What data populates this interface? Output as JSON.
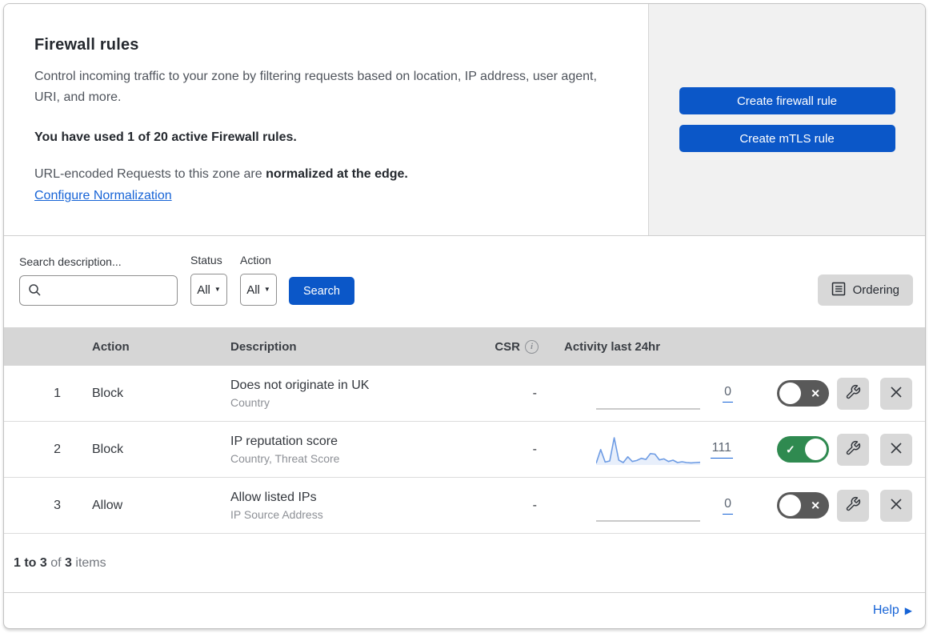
{
  "header": {
    "title": "Firewall rules",
    "description": "Control incoming traffic to your zone by filtering requests based on location, IP address, user agent, URI, and more.",
    "usage_note": "You have used 1 of 20 active Firewall rules.",
    "normalization_text": "URL-encoded Requests to this zone are ",
    "normalization_bold": "normalized at the edge.",
    "normalization_link": "Configure Normalization",
    "create_firewall_button": "Create firewall rule",
    "create_mtls_button": "Create mTLS rule"
  },
  "filters": {
    "search_label": "Search description...",
    "status_label": "Status",
    "status_value": "All",
    "action_label": "Action",
    "action_value": "All",
    "search_button": "Search",
    "ordering_button": "Ordering"
  },
  "table": {
    "columns": {
      "action": "Action",
      "description": "Description",
      "csr": "CSR",
      "activity": "Activity last 24hr"
    },
    "rows": [
      {
        "index": "1",
        "action": "Block",
        "description": "Does not originate in UK",
        "fields": "Country",
        "csr": "-",
        "activity_count": "0",
        "enabled": false,
        "sparkline": [
          0,
          0,
          0,
          0,
          0,
          0,
          0,
          0,
          0,
          0,
          0,
          0,
          0,
          0,
          0,
          0,
          0,
          0,
          0,
          0,
          0,
          0,
          0,
          0
        ]
      },
      {
        "index": "2",
        "action": "Block",
        "description": "IP reputation score",
        "fields": "Country, Threat Score",
        "csr": "-",
        "activity_count": "111",
        "enabled": true,
        "sparkline": [
          3,
          55,
          8,
          12,
          100,
          15,
          6,
          28,
          10,
          14,
          22,
          18,
          40,
          38,
          16,
          20,
          10,
          15,
          6,
          9,
          6,
          5,
          6,
          7
        ]
      },
      {
        "index": "3",
        "action": "Allow",
        "description": "Allow listed IPs",
        "fields": "IP Source Address",
        "csr": "-",
        "activity_count": "0",
        "enabled": false,
        "sparkline": [
          0,
          0,
          0,
          0,
          0,
          0,
          0,
          0,
          0,
          0,
          0,
          0,
          0,
          0,
          0,
          0,
          0,
          0,
          0,
          0,
          0,
          0,
          0,
          0
        ]
      }
    ]
  },
  "footer": {
    "range": "1 to 3",
    "of_text": " of ",
    "total": "3",
    "items_text": " items",
    "help_label": "Help"
  },
  "colors": {
    "primary_blue": "#0b57c8",
    "link_blue": "#1663d6",
    "toggle_on": "#2f8a50",
    "toggle_off": "#595959",
    "sparkline_blue": "#6e9ce4",
    "sparkline_fill": "rgba(110,156,228,0.16)",
    "flat_line": "#b9b9b9",
    "outer_border": "#c3c3c3"
  }
}
